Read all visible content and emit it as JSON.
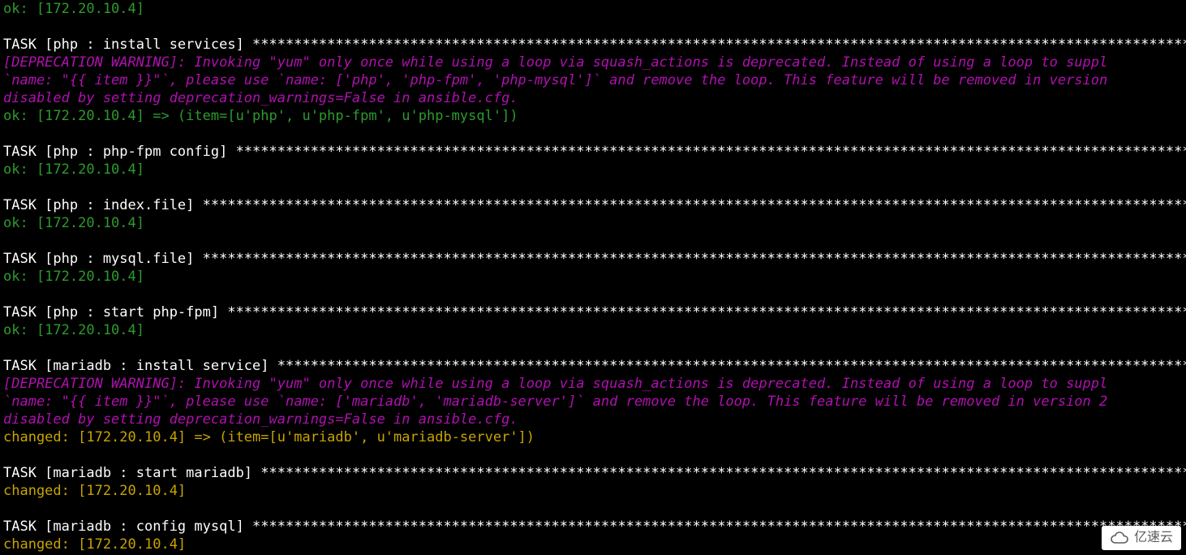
{
  "colors": {
    "ok": "#2e9a2e",
    "changed": "#c8a400",
    "warn": "#b010b0",
    "task": "#ffffff",
    "bg": "#000000"
  },
  "host": "172.20.10.4",
  "lines": [
    {
      "cls": "ok",
      "text": "ok: [172.20.10.4]"
    },
    {
      "cls": "blank",
      "text": ""
    },
    {
      "cls": "task",
      "text": "TASK [php : install services] **********************************************************************************************************************************"
    },
    {
      "cls": "warn",
      "text": "[DEPRECATION WARNING]: Invoking \"yum\" only once while using a loop via squash_actions is deprecated. Instead of using a loop to suppl"
    },
    {
      "cls": "warn",
      "text": "`name: \"{{ item }}\"`, please use `name: ['php', 'php-fpm', 'php-mysql']` and remove the loop. This feature will be removed in version"
    },
    {
      "cls": "warn",
      "text": "disabled by setting deprecation_warnings=False in ansible.cfg."
    },
    {
      "cls": "ok",
      "text": "ok: [172.20.10.4] => (item=[u'php', u'php-fpm', u'php-mysql'])"
    },
    {
      "cls": "blank",
      "text": ""
    },
    {
      "cls": "task",
      "text": "TASK [php : php-fpm config] ************************************************************************************************************************************"
    },
    {
      "cls": "ok",
      "text": "ok: [172.20.10.4]"
    },
    {
      "cls": "blank",
      "text": ""
    },
    {
      "cls": "task",
      "text": "TASK [php : index.file] ****************************************************************************************************************************************"
    },
    {
      "cls": "ok",
      "text": "ok: [172.20.10.4]"
    },
    {
      "cls": "blank",
      "text": ""
    },
    {
      "cls": "task",
      "text": "TASK [php : mysql.file] ****************************************************************************************************************************************"
    },
    {
      "cls": "ok",
      "text": "ok: [172.20.10.4]"
    },
    {
      "cls": "blank",
      "text": ""
    },
    {
      "cls": "task",
      "text": "TASK [php : start php-fpm] *************************************************************************************************************************************"
    },
    {
      "cls": "ok",
      "text": "ok: [172.20.10.4]"
    },
    {
      "cls": "blank",
      "text": ""
    },
    {
      "cls": "task",
      "text": "TASK [mariadb : install service] *******************************************************************************************************************************"
    },
    {
      "cls": "warn",
      "text": "[DEPRECATION WARNING]: Invoking \"yum\" only once while using a loop via squash_actions is deprecated. Instead of using a loop to suppl"
    },
    {
      "cls": "warn",
      "text": "`name: \"{{ item }}\"`, please use `name: ['mariadb', 'mariadb-server']` and remove the loop. This feature will be removed in version 2"
    },
    {
      "cls": "warn",
      "text": "disabled by setting deprecation_warnings=False in ansible.cfg."
    },
    {
      "cls": "changed",
      "text": "changed: [172.20.10.4] => (item=[u'mariadb', u'mariadb-server'])"
    },
    {
      "cls": "blank",
      "text": ""
    },
    {
      "cls": "task",
      "text": "TASK [mariadb : start mariadb] *********************************************************************************************************************************"
    },
    {
      "cls": "changed",
      "text": "changed: [172.20.10.4]"
    },
    {
      "cls": "blank",
      "text": ""
    },
    {
      "cls": "task",
      "text": "TASK [mariadb : config mysql] **********************************************************************************************************************************"
    },
    {
      "cls": "changed",
      "text": "changed: [172.20.10.4]"
    }
  ],
  "watermark": "亿速云"
}
